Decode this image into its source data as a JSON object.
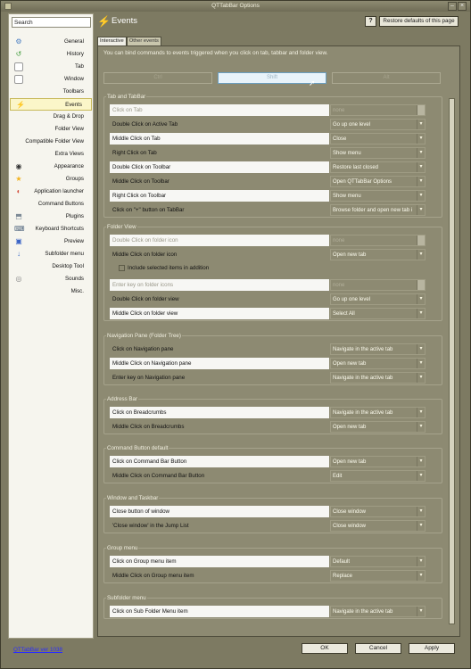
{
  "window": {
    "title": "QTTabBar Options"
  },
  "sidebar": {
    "search_value": "Search",
    "items": [
      {
        "label": "General",
        "icon": "gear-icon",
        "color": "#4a7ec2"
      },
      {
        "label": "History",
        "icon": "history-icon",
        "color": "#3f9a3a"
      },
      {
        "label": "Tab",
        "icon": "tab-icon",
        "color": "#ffffff"
      },
      {
        "label": "Window",
        "icon": "window-icon",
        "color": "#ffffff"
      },
      {
        "label": "Toolbars",
        "icon": "",
        "color": ""
      },
      {
        "label": "Events",
        "icon": "lightning-icon",
        "color": "#ffd21c"
      },
      {
        "label": "Drag & Drop",
        "icon": "",
        "color": ""
      },
      {
        "label": "Folder View",
        "icon": "",
        "color": ""
      },
      {
        "label": "Compatible Folder View",
        "icon": "",
        "color": ""
      },
      {
        "label": "Extra Views",
        "icon": "",
        "color": ""
      },
      {
        "label": "Appearance",
        "icon": "eye-icon",
        "color": "#333333"
      },
      {
        "label": "Groups",
        "icon": "star-icon",
        "color": "#f3b21b"
      },
      {
        "label": "Application launcher",
        "icon": "launcher-icon",
        "color": "#d34c3a"
      },
      {
        "label": "Command Buttons",
        "icon": "",
        "color": ""
      },
      {
        "label": "Plugins",
        "icon": "plugin-icon",
        "color": "#7d8a96"
      },
      {
        "label": "Keyboard Shortcuts",
        "icon": "keyboard-icon",
        "color": "#5a6e84"
      },
      {
        "label": "Preview",
        "icon": "preview-icon",
        "color": "#3a64c6"
      },
      {
        "label": "Subfolder menu",
        "icon": "subfolder-icon",
        "color": "#3a6ac6"
      },
      {
        "label": "Desktop Tool",
        "icon": "",
        "color": ""
      },
      {
        "label": "Sounds",
        "icon": "sound-icon",
        "color": "#8a8a8a"
      },
      {
        "label": "Misc.",
        "icon": "",
        "color": ""
      }
    ]
  },
  "header": {
    "title": "Events",
    "help_label": "?",
    "restore_label": "Restore defaults of this page"
  },
  "tabs": [
    "Interactive",
    "Other events"
  ],
  "intro": "You can bind commands to events triggered when you click on tab, tabbar and folder view.",
  "modifiers": [
    "Ctrl",
    "Shift",
    "Alt"
  ],
  "groups": [
    {
      "title": "Tab and TabBar",
      "rows": [
        {
          "label": "Click on Tab",
          "value": "none",
          "box": true,
          "dim": true
        },
        {
          "label": "Double Click on Active Tab",
          "value": "Go up one level",
          "box": false,
          "dim": false
        },
        {
          "label": "Middle Click on Tab",
          "value": "Close",
          "box": true,
          "dim": false
        },
        {
          "label": "Right Click on Tab",
          "value": "Show menu",
          "box": false,
          "dim": false
        },
        {
          "label": "Double Click on Toolbar",
          "value": "Restore last closed",
          "box": true,
          "dim": false
        },
        {
          "label": "Middle Click on Toolbar",
          "value": "Open QTTabBar Options",
          "box": false,
          "dim": false
        },
        {
          "label": "Right Click on Toolbar",
          "value": "Show menu",
          "box": true,
          "dim": false
        },
        {
          "label": "Click on \"+\" button on TabBar",
          "value": "Browse folder and open new tab i",
          "box": false,
          "dim": false
        }
      ]
    },
    {
      "title": "Folder View",
      "rows": [
        {
          "label": "Double Click on folder icon",
          "value": "none",
          "box": true,
          "dim": true
        },
        {
          "label": "Middle Click on folder icon",
          "value": "Open new tab",
          "box": false,
          "dim": false
        },
        {
          "label": "Enter key on folder icons",
          "value": "none",
          "box": true,
          "dim": true
        },
        {
          "label": "Double Click on folder view",
          "value": "Go up one level",
          "box": false,
          "dim": false
        },
        {
          "label": "Middle Click on folder view",
          "value": "Select All",
          "box": true,
          "dim": false
        }
      ],
      "checkbox": "Include selected items in addition"
    },
    {
      "title": "Navigation Pane (Folder Tree)",
      "rows": [
        {
          "label": "Click on Navigation pane",
          "value": "Navigate in the active tab",
          "box": false,
          "dim": false
        },
        {
          "label": "Middle Click on Navigation pane",
          "value": "Open new tab",
          "box": true,
          "dim": false
        },
        {
          "label": "Enter key on Navigation pane",
          "value": "Navigate in the active tab",
          "box": false,
          "dim": false
        }
      ]
    },
    {
      "title": "Address Bar",
      "rows": [
        {
          "label": "Click on Breadcrumbs",
          "value": "Navigate in the active tab",
          "box": true,
          "dim": false
        },
        {
          "label": "Middle Click on Breadcrumbs",
          "value": "Open new tab",
          "box": false,
          "dim": false
        }
      ]
    },
    {
      "title": "Command Button default",
      "rows": [
        {
          "label": "Click on Command Bar Button",
          "value": "Open new tab",
          "box": true,
          "dim": false
        },
        {
          "label": "Middle Click on Command Bar Button",
          "value": "Edit",
          "box": false,
          "dim": false
        }
      ]
    },
    {
      "title": "Window and Taskbar",
      "rows": [
        {
          "label": "Close button of window",
          "value": "Close window",
          "box": true,
          "dim": false
        },
        {
          "label": "'Close window' in the Jump List",
          "value": "Close window",
          "box": false,
          "dim": false
        }
      ]
    },
    {
      "title": "Group menu",
      "rows": [
        {
          "label": "Click on Group menu item",
          "value": "Default",
          "box": true,
          "dim": false
        },
        {
          "label": "Middle Click on Group menu item",
          "value": "Replace",
          "box": false,
          "dim": false
        }
      ]
    },
    {
      "title": "Subfolder menu",
      "rows": [
        {
          "label": "Click on Sub Folder Menu item",
          "value": "Navigate in the active tab",
          "box": true,
          "dim": false
        }
      ]
    }
  ],
  "footer": {
    "version_link": "QTTabBar ver 1038",
    "ok_label": "OK",
    "cancel_label": "Cancel",
    "apply_label": "Apply"
  }
}
